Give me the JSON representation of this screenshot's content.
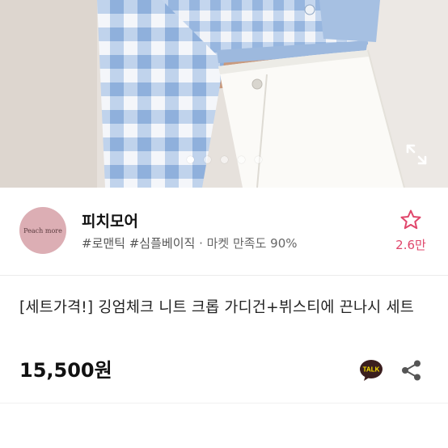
{
  "gallery": {
    "dot_count": 5,
    "active_index": 0,
    "expand_icon": "expand-icon"
  },
  "shop": {
    "logo_text": "Peach more",
    "name": "피치모어",
    "tags": "#로맨틱 #심플베이직",
    "satisfaction": "· 마켓 만족도 90%",
    "favorite_icon": "star-outline-icon",
    "favorite_count": "2.6만"
  },
  "product": {
    "title": "[세트가격!] 깅엄체크 니트 크롭 가디건+뷔스티에 끈나시 세트",
    "price": "15,500원",
    "talk_label": "TALK",
    "share_icon": "share-icon"
  },
  "colors": {
    "accent": "#e0466b",
    "gingham_light": "#a9c4e6",
    "talk_bg": "#3b1e1e",
    "talk_text": "#f9e000"
  }
}
